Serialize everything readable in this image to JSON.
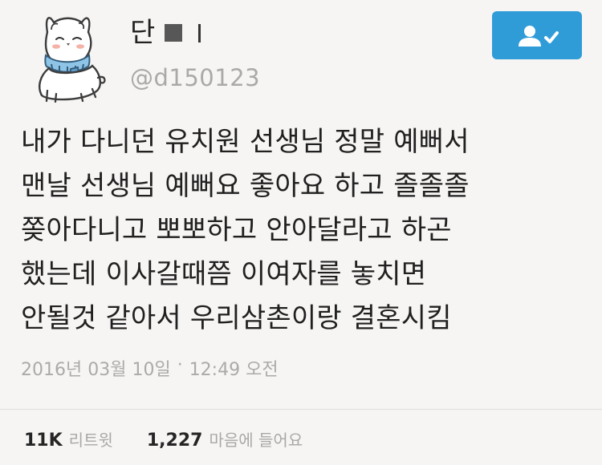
{
  "profile": {
    "display_name": "단",
    "display_suffix": "l",
    "handle": "@d150123",
    "avatar_icon": "cat-avatar-icon"
  },
  "follow": {
    "icon": "follow-user-icon",
    "color": "#2f9cd8"
  },
  "tweet": {
    "lines": [
      "내가 다니던 유치원 선생님 정말 예뻐서",
      "맨날 선생님 예뻐요 좋아요 하고 졸졸졸",
      "쫒아다니고 뽀뽀하고 안아달라고 하곤",
      "했는데 이사갈때쯤 이여자를 놓치면",
      "안될것 같아서 우리삼촌이랑 결혼시킴"
    ]
  },
  "timestamp": {
    "date": "2016년 03월 10일",
    "separator": "·",
    "time": "12:49 오전"
  },
  "stats": {
    "retweets_count": "11K",
    "retweets_label": "리트윗",
    "likes_count": "1,227",
    "likes_label": "마음에 들어요"
  }
}
